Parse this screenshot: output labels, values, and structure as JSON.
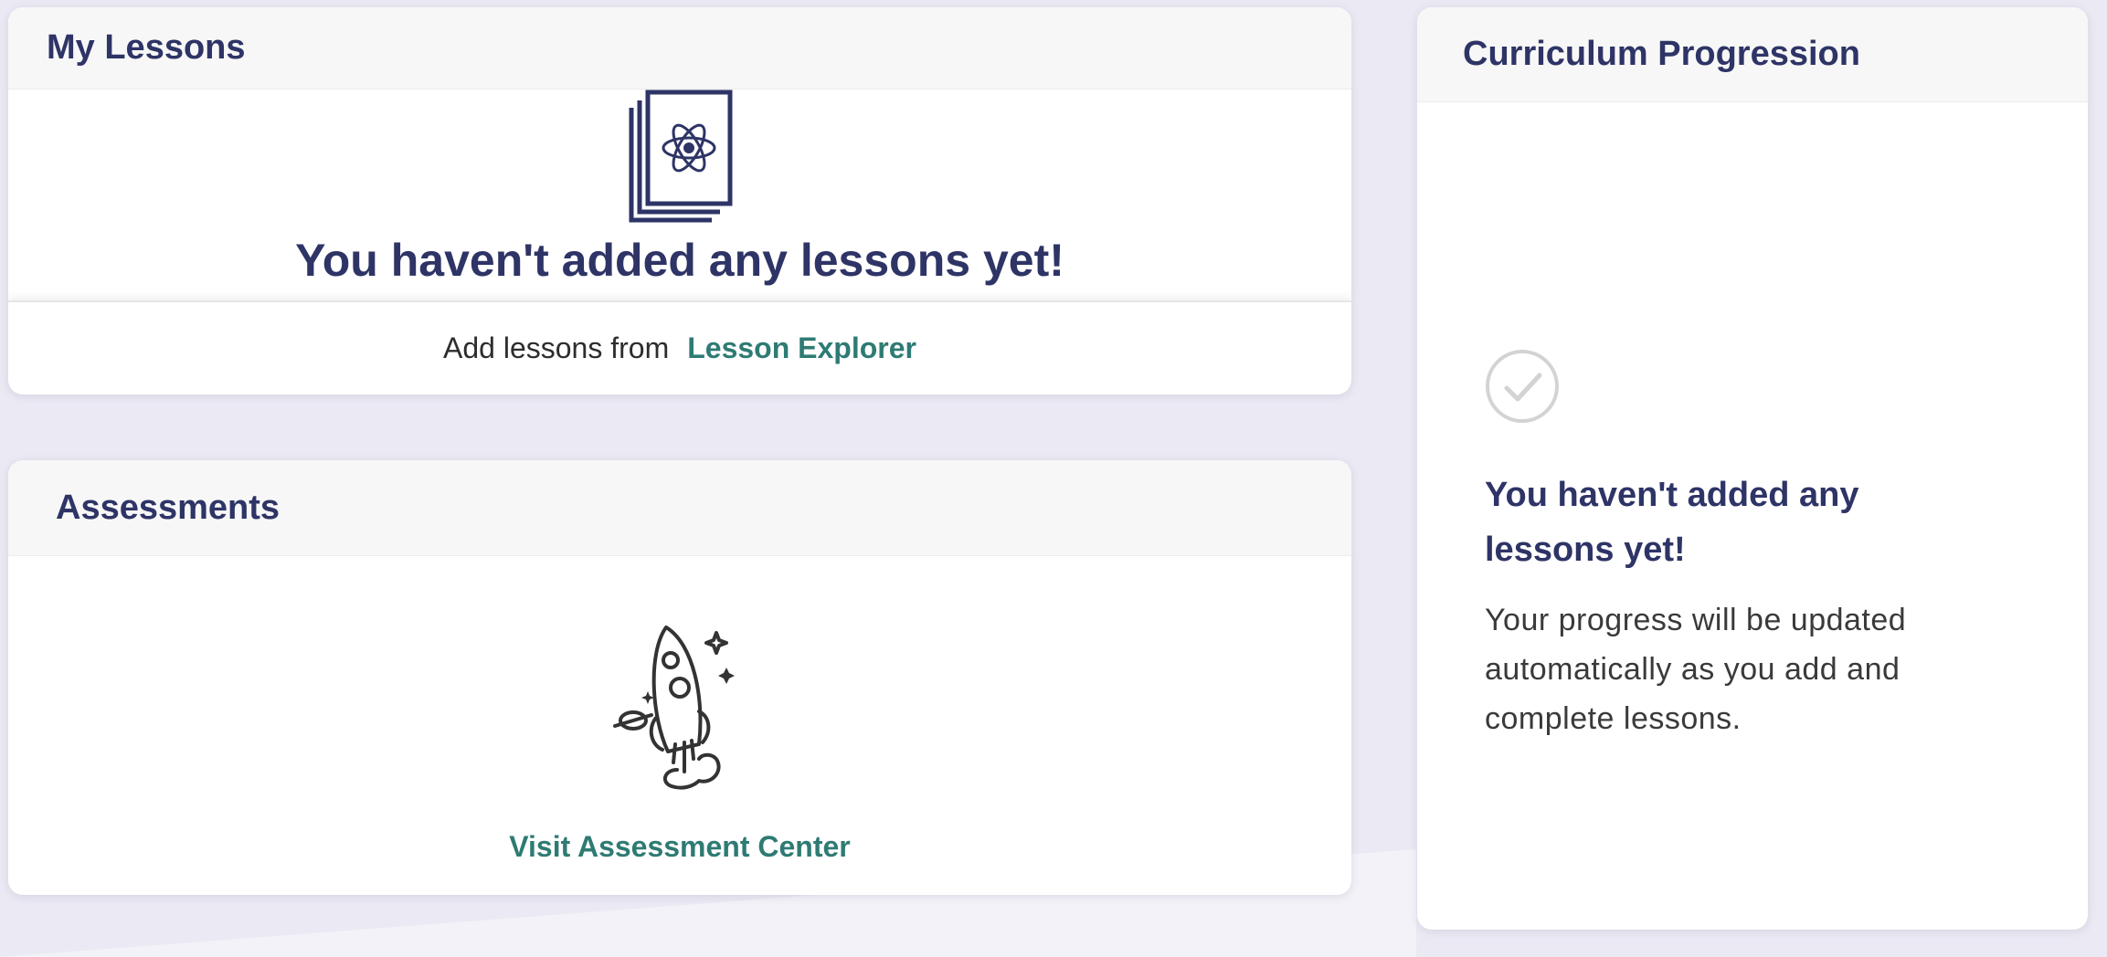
{
  "lessons": {
    "title": "My Lessons",
    "empty_message": "You haven't added any lessons yet!",
    "footer_text": "Add lessons from",
    "footer_link": "Lesson Explorer",
    "icon": "atom-book-stack-icon"
  },
  "assessments": {
    "title": "Assessments",
    "link": "Visit Assessment Center",
    "icon": "rocket-icon"
  },
  "curriculum": {
    "title": "Curriculum Progression",
    "empty_title": "You haven't added any lessons yet!",
    "description": "Your progress will be updated automatically as you add and complete lessons.",
    "icon": "check-circle-icon"
  },
  "colors": {
    "page_bg": "#ebe9f3",
    "heading": "#2e3466",
    "link": "#2e7b73",
    "card_header_bg": "#f7f7f7"
  }
}
